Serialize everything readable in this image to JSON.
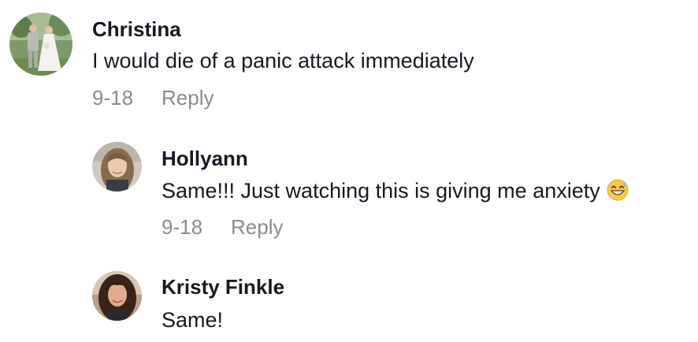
{
  "comments": [
    {
      "author": "Christina",
      "text": "I would die of a panic attack immediately",
      "date": "9-18",
      "reply_label": "Reply",
      "avatar_icon": "user-avatar-wedding-photo"
    },
    {
      "author": "Hollyann",
      "text": "Same!!! Just watching this is giving me anxiety",
      "emoji": "grinning-face-with-sweat-emoji",
      "date": "9-18",
      "reply_label": "Reply",
      "avatar_icon": "user-avatar-photo"
    },
    {
      "author": "Kristy Finkle",
      "text": "Same!",
      "avatar_icon": "user-avatar-photo"
    }
  ],
  "colors": {
    "text": "#161823",
    "muted": "#8a8b91",
    "background": "#ffffff"
  }
}
